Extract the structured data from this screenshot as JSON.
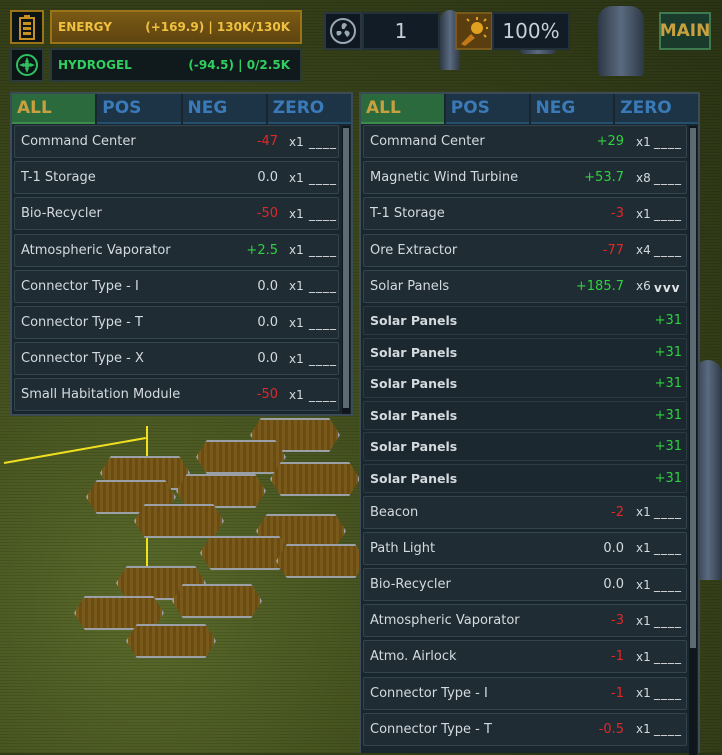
{
  "resources": {
    "energy": {
      "name": "ENERGY",
      "stats": "(+169.9) | 130K/130K",
      "icon": "battery-icon",
      "color": "#f0c040"
    },
    "hydrogel": {
      "name": "HYDROGEL",
      "stats": "(-94.5) | 0/2.5K",
      "icon": "hydrogel-icon",
      "color": "#30d060"
    }
  },
  "hud": {
    "turbine_icon": "fan-icon",
    "turbine_count": "1",
    "sun_icon": "sun-icon",
    "solar_percent": "100%",
    "main_label": "MAIN"
  },
  "tabs": [
    "ALL",
    "POS",
    "NEG",
    "ZERO"
  ],
  "left_panel": {
    "rows": [
      {
        "name": "Command Center",
        "value": "-47",
        "sign": "neg",
        "mult": "x1",
        "dash": "____"
      },
      {
        "name": "T-1 Storage",
        "value": "0.0",
        "sign": "zero",
        "mult": "x1",
        "dash": "____"
      },
      {
        "name": "Bio-Recycler",
        "value": "-50",
        "sign": "neg",
        "mult": "x1",
        "dash": "____"
      },
      {
        "name": "Atmospheric Vaporator",
        "value": "+2.5",
        "sign": "pos",
        "mult": "x1",
        "dash": "____"
      },
      {
        "name": "Connector Type - I",
        "value": "0.0",
        "sign": "zero",
        "mult": "x1",
        "dash": "____"
      },
      {
        "name": "Connector Type - T",
        "value": "0.0",
        "sign": "zero",
        "mult": "x1",
        "dash": "____"
      },
      {
        "name": "Connector Type - X",
        "value": "0.0",
        "sign": "zero",
        "mult": "x1",
        "dash": "____"
      },
      {
        "name": "Small Habitation Module",
        "value": "-50",
        "sign": "neg",
        "mult": "x1",
        "dash": "____"
      }
    ]
  },
  "right_panel": {
    "rows": [
      {
        "name": "Command Center",
        "value": "+29",
        "sign": "pos",
        "mult": "x1",
        "dash": "____"
      },
      {
        "name": "Magnetic Wind Turbine",
        "value": "+53.7",
        "sign": "pos",
        "mult": "x8",
        "dash": "____"
      },
      {
        "name": "T-1 Storage",
        "value": "-3",
        "sign": "neg",
        "mult": "x1",
        "dash": "____"
      },
      {
        "name": "Ore Extractor",
        "value": "-77",
        "sign": "neg",
        "mult": "x4",
        "dash": "____"
      },
      {
        "name": "Solar Panels",
        "value": "+185.7",
        "sign": "pos",
        "mult": "x6",
        "dash": "vvv"
      },
      {
        "name": "Solar Panels",
        "value": "+31",
        "sign": "pos",
        "mult": "",
        "dash": "",
        "sub": true
      },
      {
        "name": "Solar Panels",
        "value": "+31",
        "sign": "pos",
        "mult": "",
        "dash": "",
        "sub": true
      },
      {
        "name": "Solar Panels",
        "value": "+31",
        "sign": "pos",
        "mult": "",
        "dash": "",
        "sub": true
      },
      {
        "name": "Solar Panels",
        "value": "+31",
        "sign": "pos",
        "mult": "",
        "dash": "",
        "sub": true
      },
      {
        "name": "Solar Panels",
        "value": "+31",
        "sign": "pos",
        "mult": "",
        "dash": "",
        "sub": true
      },
      {
        "name": "Solar Panels",
        "value": "+31",
        "sign": "pos",
        "mult": "",
        "dash": "",
        "sub": true
      },
      {
        "name": "Beacon",
        "value": "-2",
        "sign": "neg",
        "mult": "x1",
        "dash": "____"
      },
      {
        "name": "Path Light",
        "value": "0.0",
        "sign": "zero",
        "mult": "x1",
        "dash": "____"
      },
      {
        "name": "Bio-Recycler",
        "value": "0.0",
        "sign": "zero",
        "mult": "x1",
        "dash": "____"
      },
      {
        "name": "Atmospheric Vaporator",
        "value": "-3",
        "sign": "neg",
        "mult": "x1",
        "dash": "____"
      },
      {
        "name": "Atmo. Airlock",
        "value": "-1",
        "sign": "neg",
        "mult": "x1",
        "dash": "____"
      },
      {
        "name": "Connector Type - I",
        "value": "-1",
        "sign": "neg",
        "mult": "x1",
        "dash": "____"
      },
      {
        "name": "Connector Type - T",
        "value": "-0.5",
        "sign": "neg",
        "mult": "x1",
        "dash": "____"
      }
    ]
  }
}
